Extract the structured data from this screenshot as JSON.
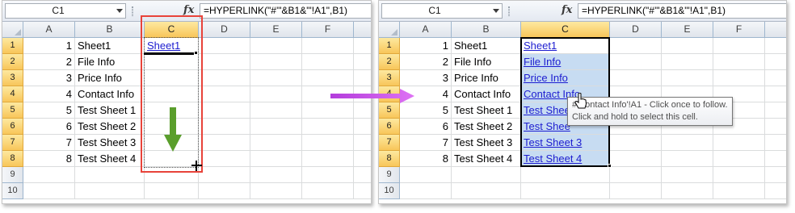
{
  "left_panel": {
    "name_box": "C1",
    "fx_label": "fx",
    "formula": "=HYPERLINK(\"#'\"&B1&\"'!A1\",B1)",
    "columns": [
      "A",
      "B",
      "C",
      "D",
      "E",
      "F"
    ],
    "rows": [
      "1",
      "2",
      "3",
      "4",
      "5",
      "6",
      "7",
      "8",
      "9",
      "10"
    ],
    "col_a": [
      "1",
      "2",
      "3",
      "4",
      "5",
      "6",
      "7",
      "8"
    ],
    "col_b": [
      "Sheet1",
      "File Info",
      "Price Info",
      "Contact Info",
      "Test Sheet 1",
      "Test Sheet 2",
      "Test Sheet 3",
      "Test Sheet 4"
    ],
    "col_c": [
      "Sheet1"
    ]
  },
  "right_panel": {
    "name_box": "C1",
    "fx_label": "fx",
    "formula": "=HYPERLINK(\"#'\"&B1&\"'!A1\",B1)",
    "columns": [
      "A",
      "B",
      "C",
      "D",
      "E",
      "F"
    ],
    "rows": [
      "1",
      "2",
      "3",
      "4",
      "5",
      "6",
      "7",
      "8",
      "9",
      "10"
    ],
    "col_a": [
      "1",
      "2",
      "3",
      "4",
      "5",
      "6",
      "7",
      "8"
    ],
    "col_b": [
      "Sheet1",
      "File Info",
      "Price Info",
      "Contact Info",
      "Test Sheet 1",
      "Test Sheet 2",
      "Test Sheet 3",
      "Test Sheet 4"
    ],
    "col_c": [
      "Sheet1",
      "File Info",
      "Price Info",
      "Contact Info",
      "Test Shee",
      "Test Shee",
      "Test Sheet 3",
      "Test Sheet 4"
    ],
    "tooltip": {
      "line1": "#'Contact Info'!A1 - Click once to follow.",
      "line2": "Click and hold to select this cell."
    }
  },
  "colors": {
    "link": "#1d1dd0",
    "selection_fill": "#c7dcf2",
    "selected_header": "#f8c65a",
    "highlight_box": "#e8433a",
    "fill_arrow": "#5a9e2c",
    "transition_arrow": "#c74ae8"
  },
  "icons": [
    "dropdown-arrow-icon",
    "fx-icon",
    "corner-select-icon",
    "fill-down-arrow-icon",
    "transition-arrow-icon",
    "fill-cursor-icon",
    "hand-pointer-icon"
  ]
}
